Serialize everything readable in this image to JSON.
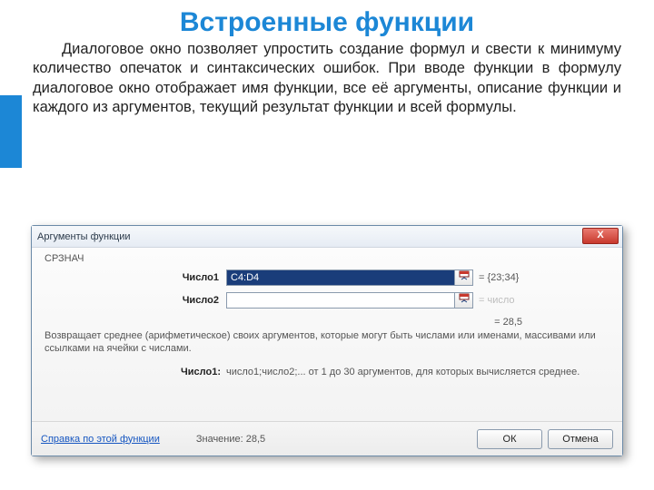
{
  "page": {
    "title": "Встроенные функции",
    "intro": "Диалоговое окно позволяет упростить создание формул и свести к минимуму количество опечаток и синтаксических ошибок. При вводе функции в формулу диалоговое окно отображает имя функции, все её аргументы, описание функции и каждого из аргументов, текущий результат функции и всей формулы."
  },
  "dialog": {
    "title": "Аргументы функции",
    "close": "X",
    "function_name": "СРЗНАЧ",
    "args": [
      {
        "label": "Число1",
        "value": "C4:D4",
        "evaluated": "= {23;34}",
        "selected": true
      },
      {
        "label": "Число2",
        "value": "",
        "evaluated": "= число",
        "selected": false,
        "dim": true
      }
    ],
    "result_line": "= 28,5",
    "description": "Возвращает среднее (арифметическое) своих аргументов, которые могут быть числами или именами, массивами или ссылками на ячейки с числами.",
    "arg_help_label": "Число1:",
    "arg_help_text": "число1;число2;... от 1 до 30 аргументов, для которых вычисляется среднее.",
    "help_link": "Справка по этой функции",
    "value_label": "Значение: 28,5",
    "ok": "ОК",
    "cancel": "Отмена"
  }
}
